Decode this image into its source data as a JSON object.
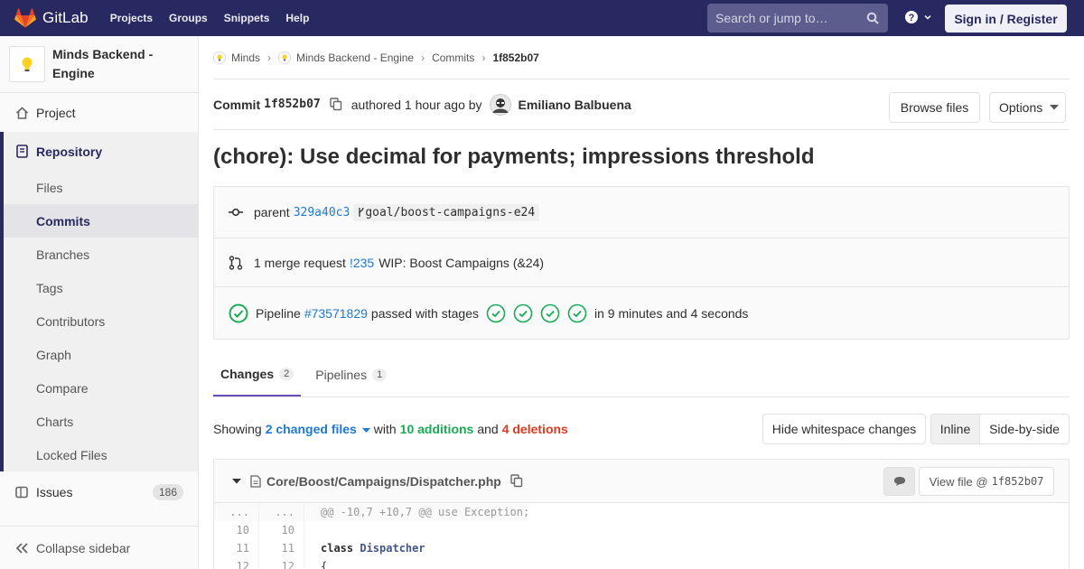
{
  "navbar": {
    "brand": "GitLab",
    "links": [
      "Projects",
      "Groups",
      "Snippets",
      "Help"
    ],
    "search_placeholder": "Search or jump to…",
    "sign_in_label": "Sign in / Register"
  },
  "sidebar": {
    "project_name": "Minds Backend - Engine",
    "project_label": "Project",
    "repository_label": "Repository",
    "repository_items": [
      "Files",
      "Commits",
      "Branches",
      "Tags",
      "Contributors",
      "Graph",
      "Compare",
      "Charts",
      "Locked Files"
    ],
    "active_item": "Commits",
    "issues_label": "Issues",
    "issues_count": "186",
    "collapse_label": "Collapse sidebar"
  },
  "breadcrumb": {
    "items": [
      "Minds",
      "Minds Backend - Engine",
      "Commits"
    ],
    "current": "1f852b07"
  },
  "commit": {
    "label": "Commit",
    "sha": "1f852b07",
    "authored": "authored 1 hour ago by",
    "author": "Emiliano Balbuena",
    "browse_files": "Browse files",
    "options": "Options",
    "title": "(chore): Use decimal for payments; impressions threshold",
    "parent_label": "parent",
    "parent_sha": "329a40c3",
    "branch": "goal/boost-campaigns-e24",
    "mr_text": "1 merge request",
    "mr_ref": "!235",
    "mr_title": "WIP: Boost Campaigns (&24)",
    "pipeline_label": "Pipeline",
    "pipeline_id": "#73571829",
    "pipeline_status": "passed with stages",
    "pipeline_duration": "in 9 minutes and 4 seconds",
    "stage_count": 4
  },
  "tabs": {
    "changes_label": "Changes",
    "changes_count": "2",
    "pipelines_label": "Pipelines",
    "pipelines_count": "1"
  },
  "diff_stats": {
    "showing": "Showing",
    "files": "2 changed files",
    "with": "with",
    "additions": "10 additions",
    "and": "and",
    "deletions": "4 deletions",
    "hide_whitespace": "Hide whitespace changes",
    "inline": "Inline",
    "side_by_side": "Side-by-side"
  },
  "file": {
    "path": "Core/Boost/Campaigns/Dispatcher.php",
    "view_file_label": "View file @",
    "view_file_sha": "1f852b07",
    "lines": [
      {
        "old": "...",
        "new": "...",
        "code": "@@ -10,7 +10,7 @@ use Exception;",
        "hunk": true
      },
      {
        "old": "10",
        "new": "10",
        "code": "",
        "hunk": false
      },
      {
        "old": "11",
        "new": "11",
        "code_kw": "class",
        "code_cls": "Dispatcher",
        "hunk": false
      },
      {
        "old": "12",
        "new": "12",
        "code": "{",
        "hunk": false
      }
    ]
  },
  "colors": {
    "navbar": "#292961",
    "accent": "#6b4fbb",
    "link": "#1f78d1",
    "success": "#1aaa55",
    "danger": "#db3b21"
  }
}
